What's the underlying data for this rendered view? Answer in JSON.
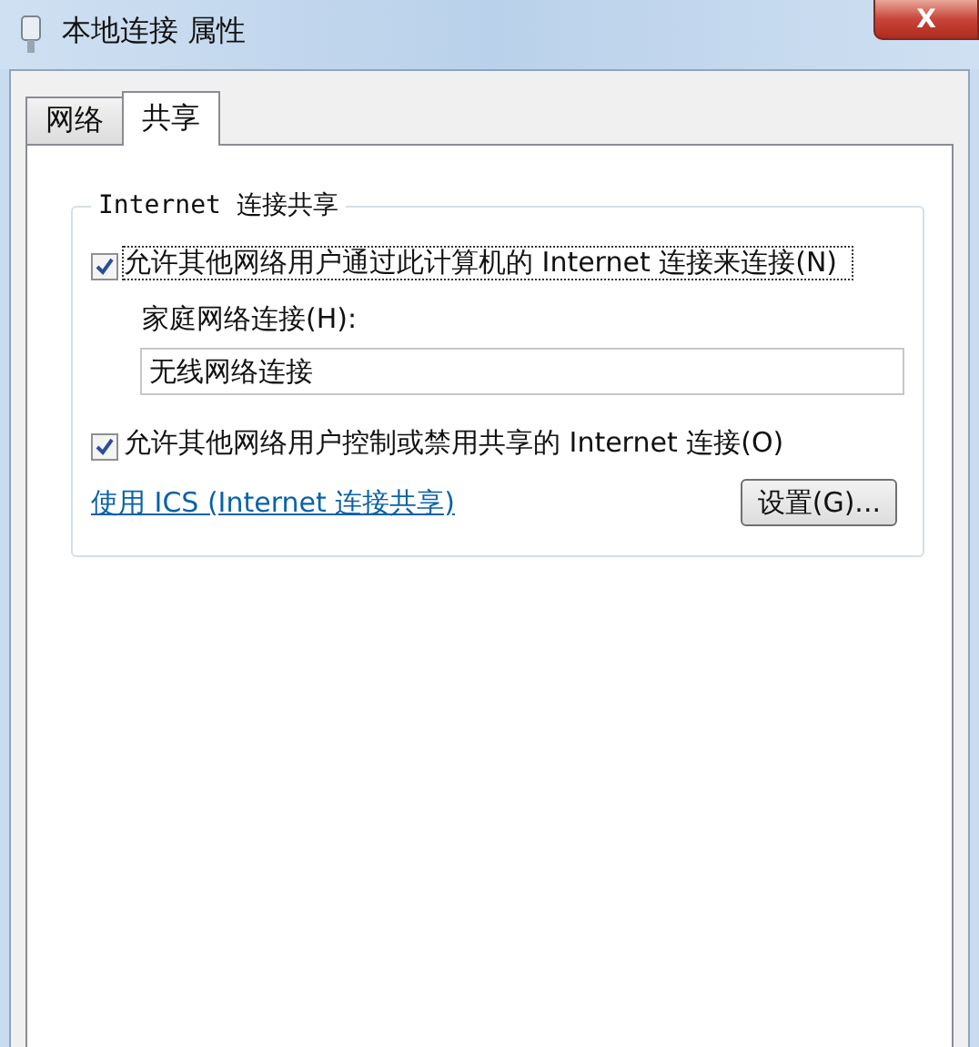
{
  "window": {
    "title": "本地连接 属性",
    "close": "X"
  },
  "tabs": [
    {
      "label": "网络",
      "selected": false
    },
    {
      "label": "共享",
      "selected": true
    }
  ],
  "group": {
    "title": "Internet 连接共享",
    "allow_connect": {
      "label": "允许其他网络用户通过此计算机的 Internet 连接来连接(N)",
      "checked": true
    },
    "home_label": "家庭网络连接(H):",
    "home_value": "无线网络连接",
    "allow_control": {
      "label": "允许其他网络用户控制或禁用共享的 Internet 连接(O)",
      "checked": true
    },
    "link": "使用 ICS (Internet 连接共享)",
    "settings_button": "设置(G)..."
  }
}
